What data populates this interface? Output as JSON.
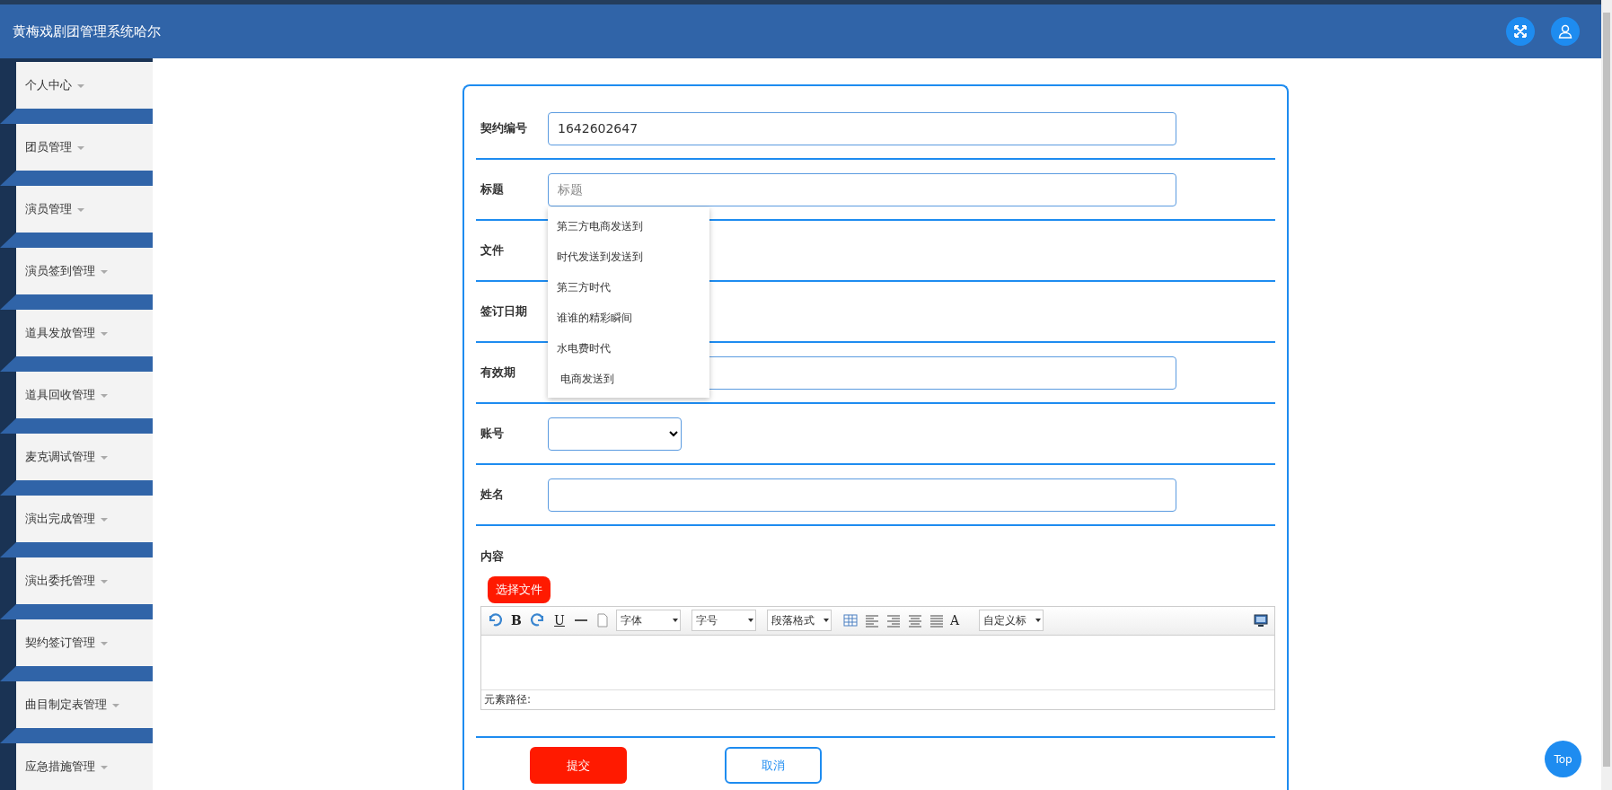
{
  "header": {
    "title": "黄梅戏剧团管理系统哈尔"
  },
  "sidebar": {
    "items": [
      {
        "label": "个人中心"
      },
      {
        "label": "团员管理"
      },
      {
        "label": "演员管理"
      },
      {
        "label": "演员签到管理"
      },
      {
        "label": "道具发放管理"
      },
      {
        "label": "道具回收管理"
      },
      {
        "label": "麦克调试管理"
      },
      {
        "label": "演出完成管理"
      },
      {
        "label": "演出委托管理"
      },
      {
        "label": "契约签订管理"
      },
      {
        "label": "曲目制定表管理"
      },
      {
        "label": "应急措施管理"
      }
    ]
  },
  "form": {
    "fields": [
      {
        "kind": "text",
        "label": "契约编号",
        "value": "1642602647"
      },
      {
        "kind": "text",
        "label": "标题",
        "placeholder": "标题",
        "suggestions": [
          "第三方电商发送到",
          "时代发送到发送到",
          "第三方时代",
          "谁谁的精彩瞬间",
          "水电费时代",
          " 电商发送到"
        ]
      },
      {
        "kind": "hidden",
        "label": "文件"
      },
      {
        "kind": "hidden",
        "label": "签订日期"
      },
      {
        "kind": "text",
        "label": "有效期"
      },
      {
        "kind": "select",
        "label": "账号"
      },
      {
        "kind": "text",
        "label": "姓名"
      },
      {
        "kind": "editor",
        "label": "内容",
        "upload_button": "选择文件",
        "path_label": "元素路径:",
        "toolbar": [
          {
            "kind": "undo"
          },
          {
            "kind": "bold",
            "text": "B"
          },
          {
            "kind": "redo"
          },
          {
            "kind": "underline",
            "text": "U"
          },
          {
            "kind": "rule"
          },
          {
            "kind": "page"
          },
          {
            "kind": "combo",
            "text": "字体"
          },
          {
            "kind": "combo",
            "text": "字号"
          },
          {
            "kind": "combo",
            "text": "段落格式"
          },
          {
            "kind": "table"
          },
          {
            "kind": "alignleft"
          },
          {
            "kind": "alignright"
          },
          {
            "kind": "aligncenter"
          },
          {
            "kind": "justify"
          },
          {
            "kind": "color",
            "text": "A"
          },
          {
            "kind": "combo",
            "text": "自定义标"
          },
          {
            "kind": "preview"
          }
        ]
      }
    ],
    "buttons": [
      {
        "kind": "submit",
        "label": "提交"
      },
      {
        "kind": "cancel",
        "label": "取消"
      }
    ]
  },
  "top_button": {
    "label": "Top"
  }
}
